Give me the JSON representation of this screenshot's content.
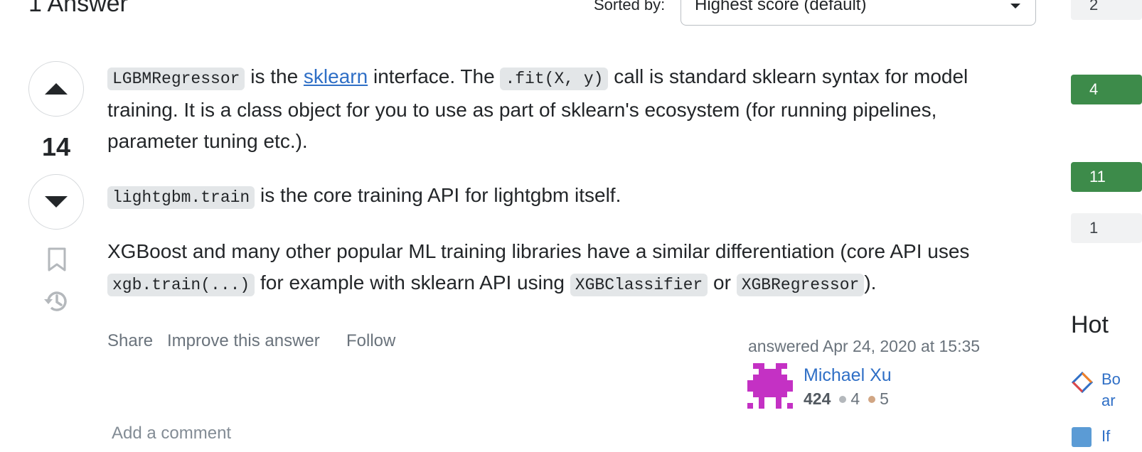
{
  "header": {
    "answers_count": "1 Answer",
    "sorted_label": "Sorted by:",
    "sort_value": "Highest score (default)"
  },
  "vote": {
    "score": "14"
  },
  "post": {
    "p1": {
      "code1": "LGBMRegressor",
      "t1": " is the ",
      "link": "sklearn",
      "t2": " interface. The ",
      "code2": ".fit(X, y)",
      "t3": " call is standard sklearn syntax for model training. It is a class object for you to use as part of sklearn's ecosystem (for running pipelines, parameter tuning etc.)."
    },
    "p2": {
      "code1": "lightgbm.train",
      "t1": " is the core training API for lightgbm itself."
    },
    "p3": {
      "t1": "XGBoost and many other popular ML training libraries have a similar differentiation (core API uses ",
      "code1": "xgb.train(...)",
      "t2": " for example with sklearn API using ",
      "code2": "XGBClassifier",
      "t3": " or ",
      "code3": "XGBRegressor",
      "t4": ")."
    }
  },
  "menu": {
    "share": "Share",
    "improve": "Improve this answer",
    "follow": "Follow"
  },
  "signature": {
    "answered": "answered Apr 24, 2020 at 15:35",
    "user_name": "Michael Xu",
    "reputation": "424",
    "silver": "4",
    "bronze": "5"
  },
  "comment": {
    "add": "Add a comment"
  },
  "sidebar": {
    "counts": [
      "2",
      "4",
      "11",
      "1"
    ],
    "hot_title": "Hot",
    "q1_line1": "Bo",
    "q1_line2": "ar",
    "q2": "If"
  },
  "colors": {
    "accepted_green": "#3d8b4a",
    "link_blue": "#2f6fc6",
    "avatar_magenta": "#c431c4",
    "silver_badge": "#b4b8bc",
    "bronze_badge": "#d1a684"
  },
  "icons": [
    "sort-arrows-icon",
    "upvote-arrow-icon",
    "downvote-arrow-icon",
    "bookmark-icon",
    "history-icon",
    "avatar-identicon",
    "site-icon"
  ]
}
